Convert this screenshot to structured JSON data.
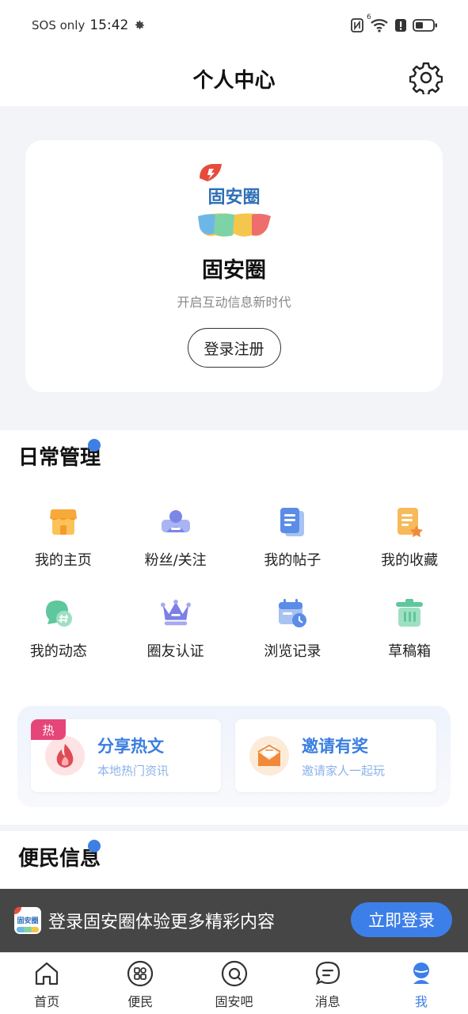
{
  "status_bar": {
    "carrier": "SOS only",
    "time": "15:42",
    "signal_badge": "6"
  },
  "header": {
    "title": "个人中心"
  },
  "profile": {
    "logo_text": "固安圈",
    "name": "固安圈",
    "slogan": "开启互动信息新时代",
    "login_label": "登录注册"
  },
  "daily": {
    "title": "日常管理",
    "items": [
      {
        "label": "我的主页",
        "icon": "shop-icon"
      },
      {
        "label": "粉丝/关注",
        "icon": "user-card-icon"
      },
      {
        "label": "我的帖子",
        "icon": "document-icon"
      },
      {
        "label": "我的收藏",
        "icon": "favorite-doc-icon"
      },
      {
        "label": "我的动态",
        "icon": "chat-hash-icon"
      },
      {
        "label": "圈友认证",
        "icon": "crown-icon"
      },
      {
        "label": "浏览记录",
        "icon": "calendar-clock-icon"
      },
      {
        "label": "草稿箱",
        "icon": "trash-bin-icon"
      }
    ]
  },
  "promos": [
    {
      "badge": "热",
      "title": "分享热文",
      "subtitle": "本地热门资讯"
    },
    {
      "title": "邀请有奖",
      "subtitle": "邀请家人一起玩"
    }
  ],
  "convenience": {
    "title": "便民信息"
  },
  "login_banner": {
    "logo_text": "固安圈",
    "text": "登录固安圈体验更多精彩内容",
    "button": "立即登录"
  },
  "bottom_nav": [
    {
      "label": "首页",
      "icon": "home-icon"
    },
    {
      "label": "便民",
      "icon": "apps-icon"
    },
    {
      "label": "固安吧",
      "icon": "community-icon"
    },
    {
      "label": "消息",
      "icon": "message-icon"
    },
    {
      "label": "我",
      "icon": "profile-icon",
      "active": true
    }
  ],
  "colors": {
    "accent": "#3d7fe8",
    "hot": "#e6457a",
    "promo_title": "#3a7ee0"
  }
}
